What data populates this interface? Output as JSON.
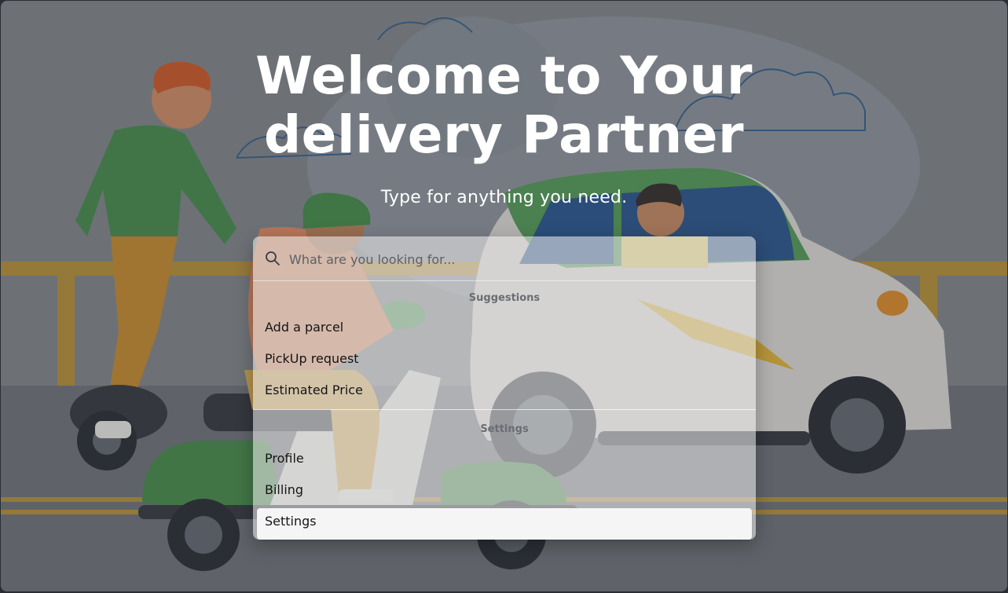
{
  "hero": {
    "title_line1": "Welcome to Your",
    "title_line2": "delivery Partner",
    "subtitle": "Type for anything you need."
  },
  "palette": {
    "search": {
      "placeholder": "What are you looking for...",
      "value": ""
    },
    "groups": [
      {
        "heading": "Suggestions",
        "items": [
          "Add a parcel",
          "PickUp request",
          "Estimated Price"
        ]
      },
      {
        "heading": "Settings",
        "items": [
          "Profile",
          "Billing",
          "Settings"
        ]
      }
    ],
    "selected_item": "Settings"
  },
  "colors": {
    "selected_item_bg": "#f5f5f5",
    "hero_text": "#ffffff",
    "illustration_green": "#4f9a52",
    "car_body": "#eceae4"
  }
}
